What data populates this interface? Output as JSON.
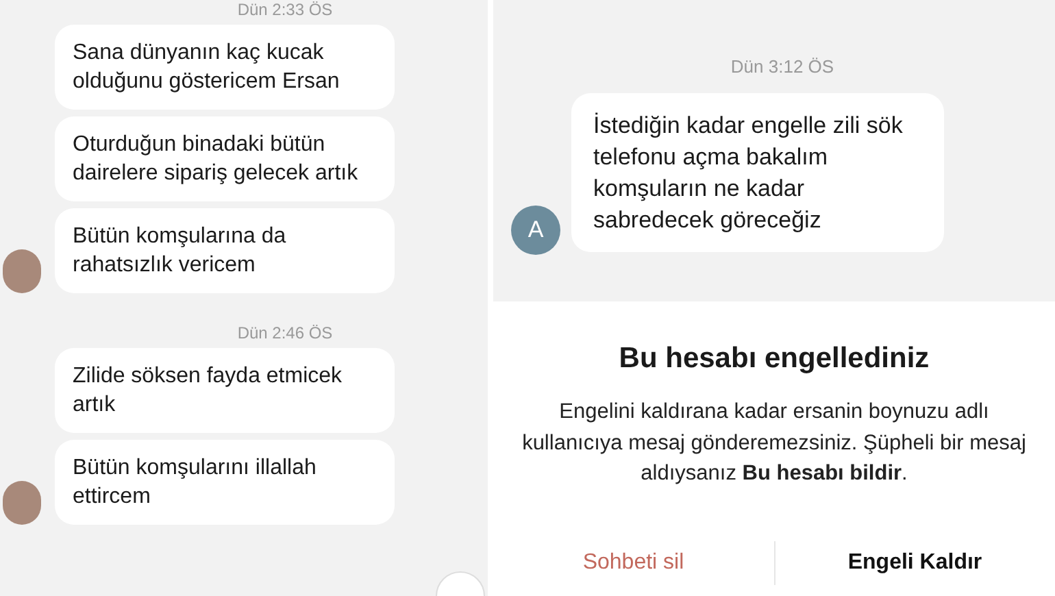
{
  "left_chat": {
    "groups": [
      {
        "timestamp": "Dün 2:33 ÖS",
        "messages": [
          {
            "text": "Sana dünyanın kaç kucak olduğunu göstericem Ersan",
            "show_avatar": false
          },
          {
            "text": "Oturduğun binadaki bütün dairelere sipariş gelecek artık",
            "show_avatar": false
          },
          {
            "text": "Bütün komşularına da rahatsızlık vericem",
            "show_avatar": true
          }
        ]
      },
      {
        "timestamp": "Dün 2:46 ÖS",
        "messages": [
          {
            "text": "Zilide söksen fayda etmicek artık",
            "show_avatar": false
          },
          {
            "text": "Bütün komşularını illallah ettircem",
            "show_avatar": true
          }
        ]
      }
    ]
  },
  "right_chat": {
    "timestamp": "Dün 3:12 ÖS",
    "message": {
      "text": "İstediğin kadar engelle zili sök telefonu açma bakalım komşuların ne kadar sabredecek göreceğiz",
      "avatar_letter": "A"
    }
  },
  "blocked_sheet": {
    "title": "Bu hesabı engellediniz",
    "body": "Engelini kaldırana kadar ersanin boynuzu adlı kullanıcıya mesaj gönderemezsiniz. Şüpheli bir mesaj aldıysanız **Bu hesabı bildir**.",
    "buttons": [
      {
        "label": "Sohbeti sil",
        "kind": "destructive"
      },
      {
        "label": "Engeli Kaldır",
        "kind": "primary"
      }
    ]
  }
}
